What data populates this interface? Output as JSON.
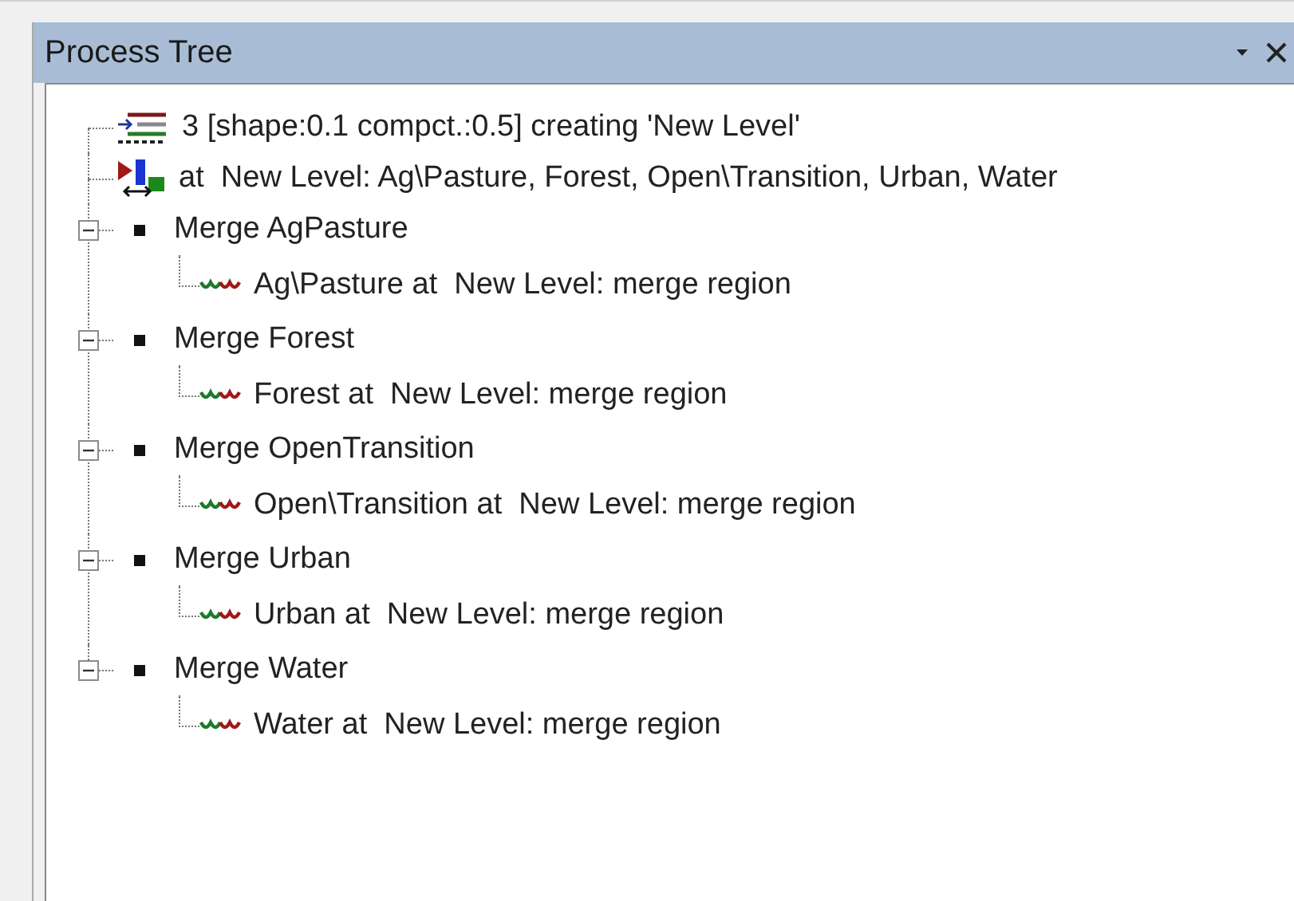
{
  "panel": {
    "title": "Process Tree"
  },
  "tree": [
    {
      "label": "3 [shape:0.1 compct.:0.5] creating 'New Level'",
      "kind": "level"
    },
    {
      "label": "at  New Level: Ag\\Pasture, Forest, Open\\Transition, Urban, Water",
      "kind": "classify"
    },
    {
      "label": "Merge AgPasture",
      "kind": "merge",
      "expanded": true,
      "children": [
        {
          "label": "Ag\\Pasture at  New Level: merge region",
          "kind": "region"
        }
      ]
    },
    {
      "label": "Merge Forest",
      "kind": "merge",
      "expanded": true,
      "children": [
        {
          "label": "Forest at  New Level: merge region",
          "kind": "region"
        }
      ]
    },
    {
      "label": "Merge OpenTransition",
      "kind": "merge",
      "expanded": true,
      "children": [
        {
          "label": "Open\\Transition at  New Level: merge region",
          "kind": "region"
        }
      ]
    },
    {
      "label": "Merge Urban",
      "kind": "merge",
      "expanded": true,
      "children": [
        {
          "label": "Urban at  New Level: merge region",
          "kind": "region"
        }
      ]
    },
    {
      "label": "Merge Water",
      "kind": "merge",
      "expanded": true,
      "children": [
        {
          "label": "Water at  New Level: merge region",
          "kind": "region"
        }
      ]
    }
  ]
}
